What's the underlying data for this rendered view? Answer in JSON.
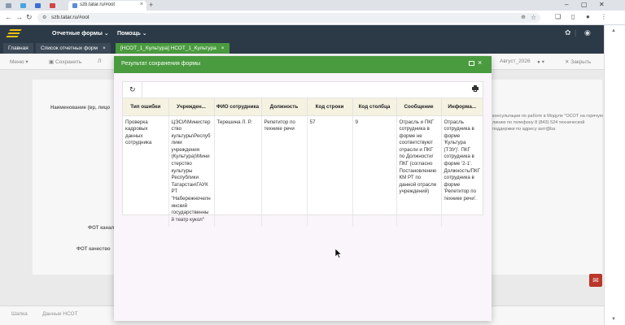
{
  "browser": {
    "tab_title": "szb.tatar.ru/#oot",
    "url": "szb.tatar.ru/#oot",
    "zoom_icon": "zoom-icon",
    "window_controls": [
      "–",
      "▢",
      "✕"
    ]
  },
  "header": {
    "menus": [
      "Отчетные формы",
      "Помощь"
    ]
  },
  "tabs": [
    {
      "label": "Главная",
      "closable": false
    },
    {
      "label": "Список отчетных форм",
      "closable": true
    },
    {
      "label": "[НСОТ_1_Культура] НСОТ_1_Культура",
      "closable": true
    }
  ],
  "toolbar": {
    "menu": "Меню",
    "save": "Сохранить",
    "period": "Август_2026",
    "close": "Закрыть",
    "partial": "Л"
  },
  "background": {
    "label_name": "Наименование (вр, лицо",
    "label_fot1": "ФОТ канал",
    "label_fot2": "ФОТ качество",
    "info_text": "консультации по работе в Модуле \"ОСОТ на горячую линию по телефону 8 (843) 524 технической поддержки по адресу asrr@ba",
    "bottom_tabs": [
      "Шапка",
      "Данные НСОТ"
    ]
  },
  "modal": {
    "title": "Результат сохранения формы",
    "columns": [
      "Тип ошибки",
      "Учрежден...",
      "ФИО сотрудника",
      "Должность",
      "Код строки",
      "Код столбца",
      "Сообщение",
      "Информа..."
    ],
    "rows": [
      {
        "error_type": "Проверка кадровых данных сотрудника",
        "institution": "ЦЭСИ\\Министерство культуры\\Республики учреждения (Культура)\\Министерство культуры Республики Татарстан\\ГАУК РТ \"Набережночелнинский государственный театр кукол\"",
        "employee": "Терешина Л. Р.",
        "position": "Репетитор по технике речи",
        "row_code": "57",
        "col_code": "9",
        "message": "Отрасль и ПКГ сотрудника в форме не соответствуют отрасли и ПКГ по Должности/ПКГ (согласно Постановлению КМ РТ по данной отрасли учреждений)",
        "info": "Отрасль сотрудника в форме 'Культура (ТЭУ)'. ПКГ сотрудника в форме '2-1'. Должность/ПКГ сотрудника в форме 'Репетитор по технике речи'."
      }
    ]
  }
}
